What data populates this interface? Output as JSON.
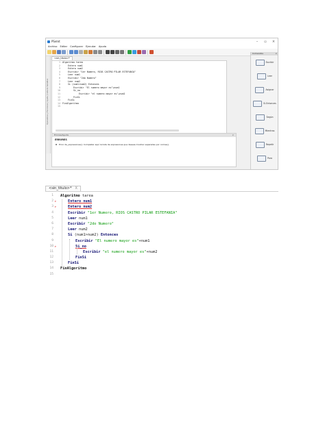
{
  "window": {
    "title": "PSeInt",
    "menu": [
      "Archivo",
      "Editar",
      "Configurar",
      "Ejecutar",
      "Ayuda"
    ],
    "tab_label": "<sin_titulo>*",
    "code_lines": [
      "Algoritmo tarea",
      "    Entero num1",
      "    Entero num2",
      "    Escribir \"1er Numero, RIOS CASTRO PILAR ESTEFANIA\"",
      "    Leer num1",
      "    Escribir \"2do Numero\"",
      "    Leer num2",
      "    Si (num1>num2) Entonces",
      "        Escribir \"El numero mayor es\"+num1",
      "        Si_no",
      "            Escribir \"el numero mayor es\"+num2",
      "        FinSi",
      "    FinSi",
      "FinAlgoritmo",
      ""
    ],
    "error_panel": {
      "header": "Errores/Ayuda",
      "title": "ERRORES",
      "item": "Error de_expresiones(): Completar aquí la lista de expresiones que deseas mostrar separadas por comas()."
    },
    "commands_panel": {
      "header": "Comandos",
      "items": [
        "Escribir",
        "Leer",
        "Asignar",
        "Si-Entonces",
        "Según",
        "Mientras",
        "Repetir",
        "Para",
        "Función"
      ]
    },
    "left_strip_label": "Operadores y Funciones | Ayuda | Lista de Variables",
    "right_strip_label": "Ejecución Paso a Paso"
  },
  "zoom": {
    "tab_label": "<sin_titulo>*",
    "tab_close": "X",
    "lines": [
      {
        "n": "1",
        "mark": "",
        "indent": 0,
        "tokens": [
          {
            "t": "Algoritmo",
            "c": "kw"
          },
          {
            "t": " tarea",
            "c": ""
          }
        ]
      },
      {
        "n": "2",
        "mark": "⊳",
        "indent": 1,
        "tokens": [
          {
            "t": "Entero num1",
            "c": "kwb ul"
          }
        ]
      },
      {
        "n": "3",
        "mark": "⊳",
        "indent": 1,
        "tokens": [
          {
            "t": "Entero num2",
            "c": "kwb ul"
          }
        ]
      },
      {
        "n": "4",
        "mark": "",
        "indent": 1,
        "tokens": [
          {
            "t": "Escribir",
            "c": "kwb"
          },
          {
            "t": " \"1er Numero, RIOS CASTRO PILAR ESTEFANIA\"",
            "c": "str"
          }
        ]
      },
      {
        "n": "5",
        "mark": "",
        "indent": 1,
        "tokens": [
          {
            "t": "Leer",
            "c": "kwb"
          },
          {
            "t": " num1",
            "c": ""
          }
        ]
      },
      {
        "n": "6",
        "mark": "",
        "indent": 1,
        "tokens": [
          {
            "t": "Escribir",
            "c": "kwb"
          },
          {
            "t": " \"2do Numero\"",
            "c": "str"
          }
        ]
      },
      {
        "n": "7",
        "mark": "",
        "indent": 1,
        "tokens": [
          {
            "t": "Leer",
            "c": "kwb"
          },
          {
            "t": " num2",
            "c": ""
          }
        ]
      },
      {
        "n": "8",
        "mark": "",
        "indent": 1,
        "tokens": [
          {
            "t": "Si",
            "c": "kwb"
          },
          {
            "t": " (num1>num2) ",
            "c": ""
          },
          {
            "t": "Entonces",
            "c": "kwb"
          }
        ]
      },
      {
        "n": "9",
        "mark": "",
        "indent": 2,
        "tokens": [
          {
            "t": "Escribir",
            "c": "kwb"
          },
          {
            "t": " \"El numero mayor es\"",
            "c": "str"
          },
          {
            "t": "+num1",
            "c": ""
          }
        ]
      },
      {
        "n": "10",
        "mark": "⊳",
        "indent": 2,
        "tokens": [
          {
            "t": "Si_no",
            "c": "kwb ul"
          }
        ]
      },
      {
        "n": "11",
        "mark": "",
        "indent": 3,
        "tokens": [
          {
            "t": "Escribir",
            "c": "kwb"
          },
          {
            "t": " \"el numero mayor es\"",
            "c": "str"
          },
          {
            "t": "+num2",
            "c": ""
          }
        ]
      },
      {
        "n": "12",
        "mark": "",
        "indent": 2,
        "tokens": [
          {
            "t": "FinSi",
            "c": "kwb"
          }
        ]
      },
      {
        "n": "13",
        "mark": "",
        "indent": 1,
        "tokens": [
          {
            "t": "FinSi",
            "c": "kwb"
          }
        ]
      },
      {
        "n": "14",
        "mark": "",
        "indent": 0,
        "tokens": [
          {
            "t": "FinAlgoritmo",
            "c": "kw"
          }
        ]
      },
      {
        "n": "15",
        "mark": "",
        "indent": 0,
        "tokens": []
      }
    ]
  }
}
